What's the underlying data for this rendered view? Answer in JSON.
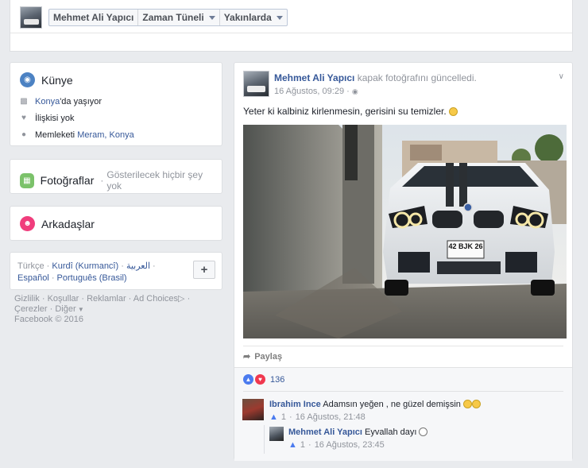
{
  "topbar": {
    "tabs": [
      {
        "label": "Mehmet Ali Yapıcı",
        "dropdown": false
      },
      {
        "label": "Zaman Tüneli",
        "dropdown": true
      },
      {
        "label": "Yakınlarda",
        "dropdown": true
      }
    ]
  },
  "kunye": {
    "title": "Künye",
    "lives_city": "Konya",
    "lives_suffix": "'da yaşıyor",
    "relationship": "İlişkisi yok",
    "hometown_prefix": "Memleketi ",
    "hometown": "Meram, Konya"
  },
  "photos": {
    "title": "Fotoğraflar",
    "dot": "·",
    "empty": "Gösterilecek hiçbir şey yok"
  },
  "friends": {
    "title": "Arkadaşlar"
  },
  "languages": {
    "items": [
      "Türkçe",
      "Kurdî (Kurmancî)",
      "العربية",
      "Español",
      "Português (Brasil)"
    ],
    "sep": " · ",
    "add_label": "+"
  },
  "footer": {
    "links": [
      "Gizlilik",
      "Koşullar",
      "Reklamlar",
      "Ad Choices",
      "Çerezler",
      "Diğer"
    ],
    "sep": " · ",
    "copyright": "Facebook © 2016"
  },
  "post": {
    "author": "Mehmet Ali Yapıcı",
    "action": "kapak fotoğrafını güncelledi.",
    "time": "16 Ağustos, 09:29",
    "dot": "·",
    "text": "Yeter ki kalbiniz kirlenmesin, gerisini su temizler.",
    "share_label": "Paylaş",
    "reaction_count": "136",
    "plate": "42 BJK 26"
  },
  "comments": [
    {
      "author": "Ibrahim Ince",
      "text": "Adamsın yeğen , ne güzel demişsin",
      "likes": "1",
      "time": "16 Ağustos, 21:48"
    },
    {
      "author": "Mehmet Ali Yapıcı",
      "text": "Eyvallah dayı",
      "likes": "1",
      "time": "16 Ağustos, 23:45"
    }
  ],
  "colors": {
    "link": "#365899",
    "muted": "#90949c",
    "background": "#e9ebee"
  }
}
